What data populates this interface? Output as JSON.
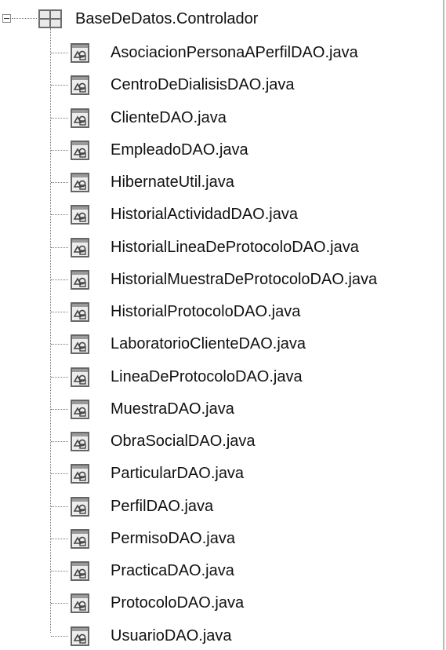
{
  "tree": {
    "root": {
      "label": "BaseDeDatos.Controlador",
      "icon": "package-icon",
      "expanded": true
    },
    "files": [
      {
        "label": "AsociacionPersonaAPerfilDAO.java",
        "icon": "java-file-icon"
      },
      {
        "label": "CentroDeDialisisDAO.java",
        "icon": "java-file-icon"
      },
      {
        "label": "ClienteDAO.java",
        "icon": "java-file-icon"
      },
      {
        "label": "EmpleadoDAO.java",
        "icon": "java-file-icon"
      },
      {
        "label": "HibernateUtil.java",
        "icon": "java-file-icon"
      },
      {
        "label": "HistorialActividadDAO.java",
        "icon": "java-file-icon"
      },
      {
        "label": "HistorialLineaDeProtocoloDAO.java",
        "icon": "java-file-icon"
      },
      {
        "label": "HistorialMuestraDeProtocoloDAO.java",
        "icon": "java-file-icon"
      },
      {
        "label": "HistorialProtocoloDAO.java",
        "icon": "java-file-icon"
      },
      {
        "label": "LaboratorioClienteDAO.java",
        "icon": "java-file-icon"
      },
      {
        "label": "LineaDeProtocoloDAO.java",
        "icon": "java-file-icon"
      },
      {
        "label": "MuestraDAO.java",
        "icon": "java-file-icon"
      },
      {
        "label": "ObraSocialDAO.java",
        "icon": "java-file-icon"
      },
      {
        "label": "ParticularDAO.java",
        "icon": "java-file-icon"
      },
      {
        "label": "PerfilDAO.java",
        "icon": "java-file-icon"
      },
      {
        "label": "PermisoDAO.java",
        "icon": "java-file-icon"
      },
      {
        "label": "PracticaDAO.java",
        "icon": "java-file-icon"
      },
      {
        "label": "ProtocoloDAO.java",
        "icon": "java-file-icon"
      },
      {
        "label": "UsuarioDAO.java",
        "icon": "java-file-icon"
      }
    ]
  }
}
